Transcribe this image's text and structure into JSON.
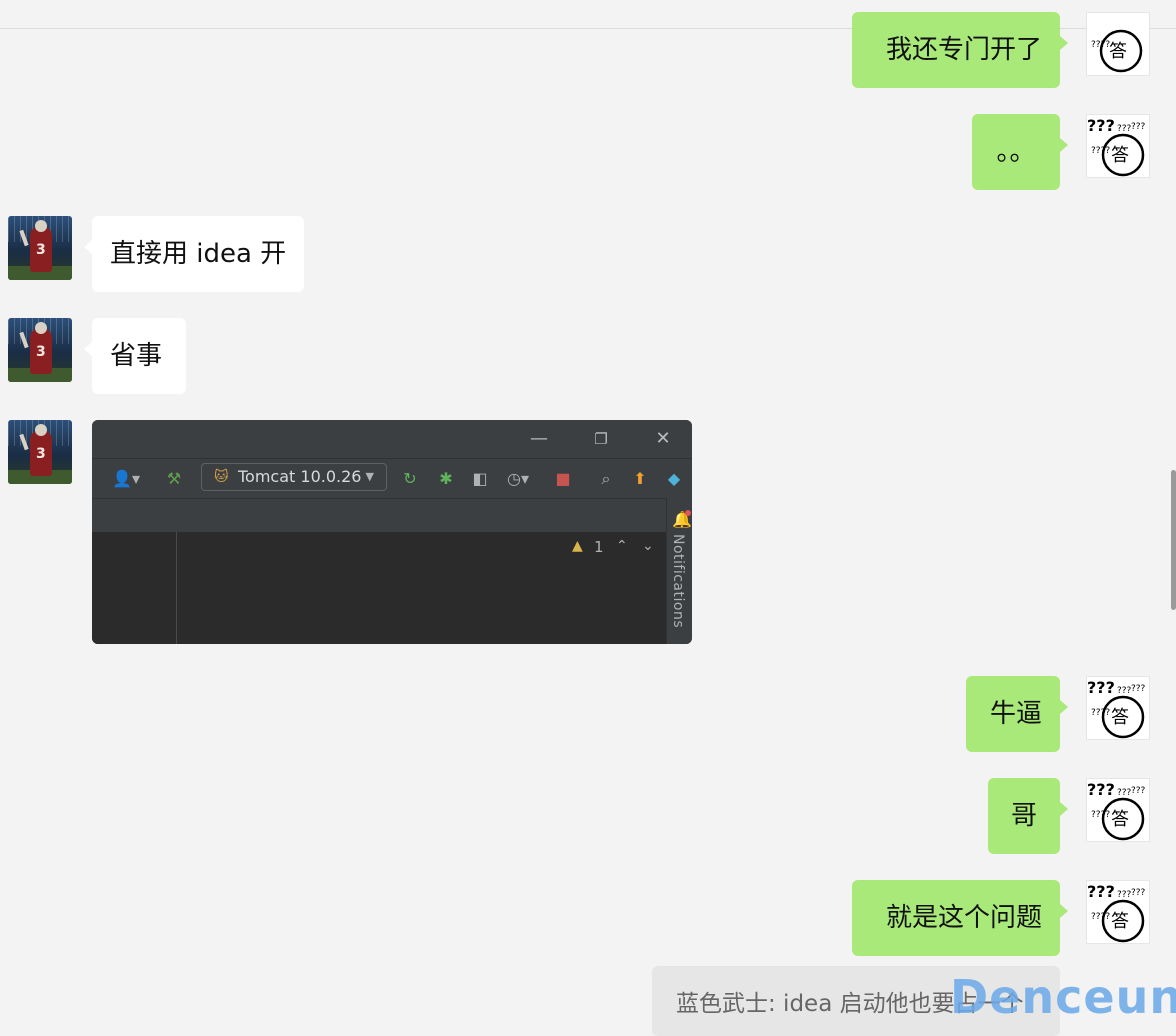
{
  "messages": {
    "m1": {
      "text": "我还专门开了"
    },
    "m2": {
      "text": "。。"
    },
    "m3": {
      "text": "直接用 idea 开"
    },
    "m4": {
      "text": "省事"
    },
    "m6": {
      "text": "牛逼"
    },
    "m7": {
      "text": "哥"
    },
    "m8": {
      "text": "就是这个问题"
    }
  },
  "sticker": {
    "top": "???",
    "top_small": "???",
    "side": "????",
    "face_char": "答"
  },
  "ide": {
    "run_config": "Tomcat 10.0.26",
    "notifications_label": "Notifications",
    "warning_count": "1"
  },
  "quote": {
    "text": "蓝色武士: idea 启动他也要占一个"
  },
  "watermark": "Denceun"
}
